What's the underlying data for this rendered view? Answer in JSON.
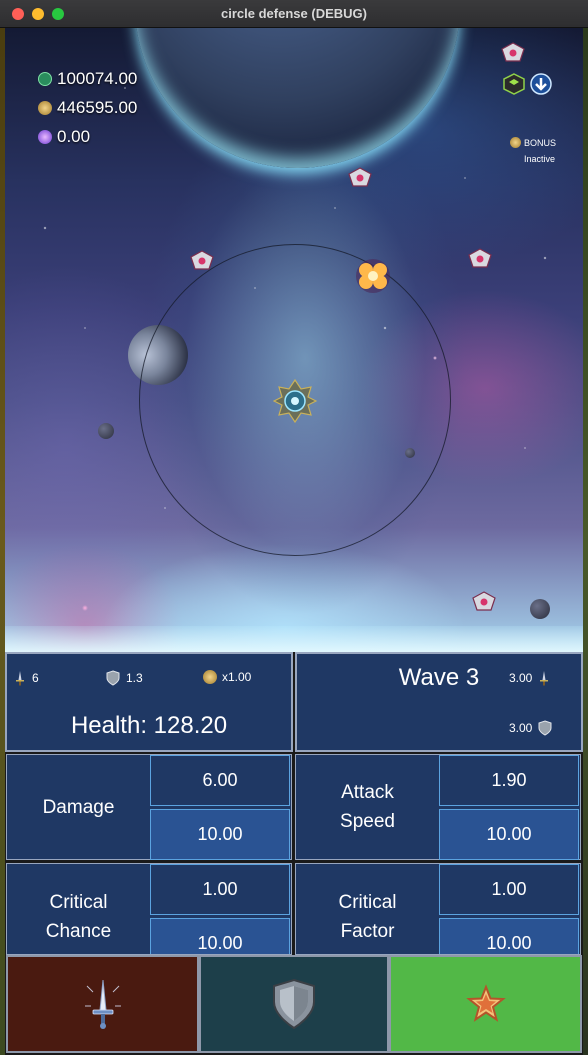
{
  "window": {
    "title": "circle defense (DEBUG)"
  },
  "currencies": [
    {
      "icon": "cash-icon",
      "value": "100074.00"
    },
    {
      "icon": "coin-icon",
      "value": "446595.00"
    },
    {
      "icon": "gem-icon",
      "value": "0.00"
    }
  ],
  "bonus": {
    "label": "BONUS",
    "state": "Inactive"
  },
  "stats": {
    "damage": "6",
    "defense": "1.3",
    "multiplier": "x1.00",
    "health_text": "Health: 128.20",
    "wave_text": "Wave 3",
    "attack_rate": "3.00",
    "shield_rate": "3.00"
  },
  "upgrades": [
    {
      "label": "Damage",
      "value": "6.00",
      "cost": "10.00"
    },
    {
      "label": "Attack Speed",
      "value": "1.90",
      "cost": "10.00"
    },
    {
      "label": "Critical Chance",
      "value": "1.00",
      "cost": "10.00"
    },
    {
      "label": "Critical Factor",
      "value": "1.00",
      "cost": "10.00"
    }
  ],
  "tabs": [
    {
      "icon": "sword-icon",
      "color": "#4a1a10"
    },
    {
      "icon": "shield-icon",
      "color": "#1d3f4a"
    },
    {
      "icon": "star-icon",
      "color": "#52b847"
    }
  ],
  "colors": {
    "panel": "#1f3864",
    "cost_bg": "#2a5393",
    "accent_border": "#5ba3e0"
  }
}
